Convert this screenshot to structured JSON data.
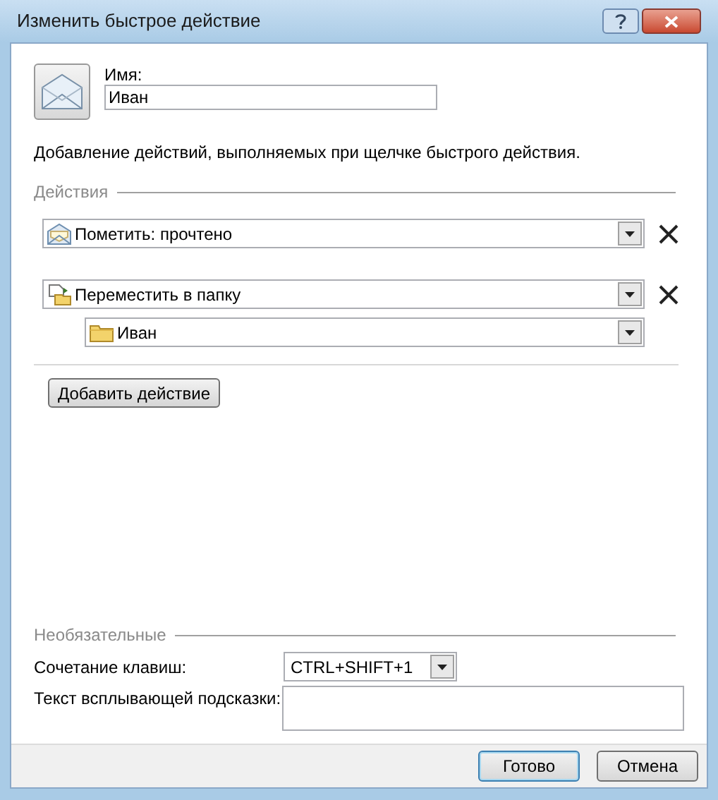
{
  "window": {
    "title": "Изменить быстрое действие"
  },
  "name_field": {
    "label": "Имя:",
    "value": "Иван"
  },
  "description": "Добавление действий, выполняемых при щелчке быстрого действия.",
  "actions_section": {
    "title": "Действия"
  },
  "actions": [
    {
      "kind": "mark",
      "value": "Пометить: прочтено"
    },
    {
      "kind": "move",
      "value": "Переместить в папку",
      "folder": "Иван"
    }
  ],
  "add_button": "Добавить действие",
  "optional_section": {
    "title": "Необязательные",
    "shortcut_label": "Сочетание клавиш:",
    "shortcut_value": "CTRL+SHIFT+1",
    "tooltip_label": "Текст всплывающей подсказки:"
  },
  "buttons": [
    {
      "label": "Готово",
      "default": true
    },
    {
      "label": "Отмена",
      "default": false
    }
  ]
}
